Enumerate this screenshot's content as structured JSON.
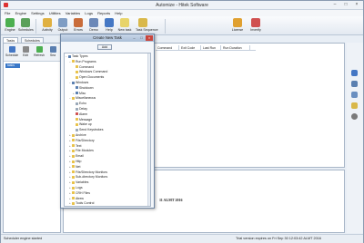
{
  "window": {
    "title": "Automize - Hitek Software",
    "minimize": "–",
    "maximize": "□",
    "close": "×"
  },
  "menu": [
    "File",
    "Engine",
    "Settings",
    "Utilities",
    "Variables",
    "Logs",
    "Reports",
    "Help"
  ],
  "ribbon": [
    {
      "label": "Engine",
      "icon": "engine-icon",
      "color": "#4caf50"
    },
    {
      "label": "Schedules",
      "icon": "schedules-icon",
      "color": "#5aa05a"
    },
    {
      "label": "Activity",
      "icon": "activity-icon",
      "color": "#e0b040"
    },
    {
      "label": "Output",
      "icon": "output-icon",
      "color": "#7f9dc4"
    },
    {
      "label": "Errors",
      "icon": "errors-icon",
      "color": "#c96c3a"
    },
    {
      "label": "Demo",
      "icon": "demo-icon",
      "color": "#6b88b8"
    },
    {
      "label": "Help",
      "icon": "help-icon",
      "color": "#4477c4"
    },
    {
      "label": "New task",
      "icon": "new-task-icon",
      "color": "#e8d46a"
    },
    {
      "label": "Task Sequence",
      "icon": "task-sequence-icon",
      "color": "#d9b84a"
    },
    {
      "label": "License",
      "icon": "license-icon",
      "color": "#e0a030"
    },
    {
      "label": "Inverify",
      "icon": "inverify-icon",
      "color": "#d05050"
    }
  ],
  "tabs": [
    "Tasks",
    "Schedules"
  ],
  "left_tools": [
    {
      "label": "Schedule",
      "icon": "schedule-icon",
      "color": "#4477c4"
    },
    {
      "label": "Edit",
      "icon": "edit-icon",
      "color": "#888888"
    },
    {
      "label": "Refresh",
      "icon": "refresh-icon",
      "color": "#4caf50"
    },
    {
      "label": "Sea",
      "icon": "search-icon",
      "color": "#5a7fb0"
    }
  ],
  "tree_selected": "tasks",
  "grid_columns": [
    "Command",
    "Exit Code",
    "Last Run",
    "Run Duration"
  ],
  "log_line": "11 ALMT 2016",
  "status": {
    "left": "Scheduler engine started",
    "right": "Trial version expires on Fri Sep 30 12:03:42 ALMT 2016"
  },
  "dialog": {
    "title": "Create New Task",
    "add_button": "Add",
    "tree": [
      {
        "label": "Task Types",
        "level": 0,
        "exp": "−",
        "color": "#5a7fb0"
      },
      {
        "label": "Run Programs",
        "level": 1,
        "exp": "−",
        "color": "#e8c24a"
      },
      {
        "label": "Command",
        "level": 2,
        "exp": "",
        "color": "#e8c24a"
      },
      {
        "label": "Windows Command",
        "level": 2,
        "exp": "",
        "color": "#e8c24a"
      },
      {
        "label": "Open Documents",
        "level": 2,
        "exp": "",
        "color": "#e8c24a"
      },
      {
        "label": "Windows",
        "level": 1,
        "exp": "−",
        "color": "#5a7fb0"
      },
      {
        "label": "Shutdown",
        "level": 2,
        "exp": "",
        "color": "#5a7fb0"
      },
      {
        "label": "Misc",
        "level": 2,
        "exp": "+",
        "color": "#5a7fb0"
      },
      {
        "label": "Miscellaneous",
        "level": 1,
        "exp": "−",
        "color": "#e8c24a"
      },
      {
        "label": "Echo",
        "level": 2,
        "exp": "",
        "color": "#9aa8b8"
      },
      {
        "label": "Delay",
        "level": 2,
        "exp": "",
        "color": "#9aa8b8"
      },
      {
        "label": "Alarm",
        "level": 2,
        "exp": "",
        "color": "#d05050"
      },
      {
        "label": "Message",
        "level": 2,
        "exp": "",
        "color": "#e8c24a"
      },
      {
        "label": "Wake up",
        "level": 2,
        "exp": "",
        "color": "#e8c24a"
      },
      {
        "label": "Send Keystrokes",
        "level": 2,
        "exp": "",
        "color": "#9aa8b8"
      },
      {
        "label": "Archive",
        "level": 1,
        "exp": "+",
        "color": "#e8c24a"
      },
      {
        "label": "File/Directory",
        "level": 1,
        "exp": "+",
        "color": "#e8c24a"
      },
      {
        "label": "Text",
        "level": 1,
        "exp": "+",
        "color": "#e8c24a"
      },
      {
        "label": "File Modules",
        "level": 1,
        "exp": "+",
        "color": "#e8c24a"
      },
      {
        "label": "Email",
        "level": 1,
        "exp": "+",
        "color": "#e8c24a"
      },
      {
        "label": "Http",
        "level": 1,
        "exp": "+",
        "color": "#e8c24a"
      },
      {
        "label": "Net",
        "level": 1,
        "exp": "+",
        "color": "#e8c24a"
      },
      {
        "label": "File/Directory Monitors",
        "level": 1,
        "exp": "+",
        "color": "#e8c24a"
      },
      {
        "label": "Sub-directory Monitors",
        "level": 1,
        "exp": "+",
        "color": "#e8c24a"
      },
      {
        "label": "Variables",
        "level": 1,
        "exp": "+",
        "color": "#e8c24a"
      },
      {
        "label": "Logs",
        "level": 1,
        "exp": "+",
        "color": "#e8c24a"
      },
      {
        "label": "CRH Files",
        "level": 1,
        "exp": "+",
        "color": "#e8c24a"
      },
      {
        "label": "Atrew",
        "level": 1,
        "exp": "+",
        "color": "#e8c24a"
      },
      {
        "label": "Tools Control",
        "level": 1,
        "exp": "+",
        "color": "#e8c24a"
      }
    ]
  }
}
